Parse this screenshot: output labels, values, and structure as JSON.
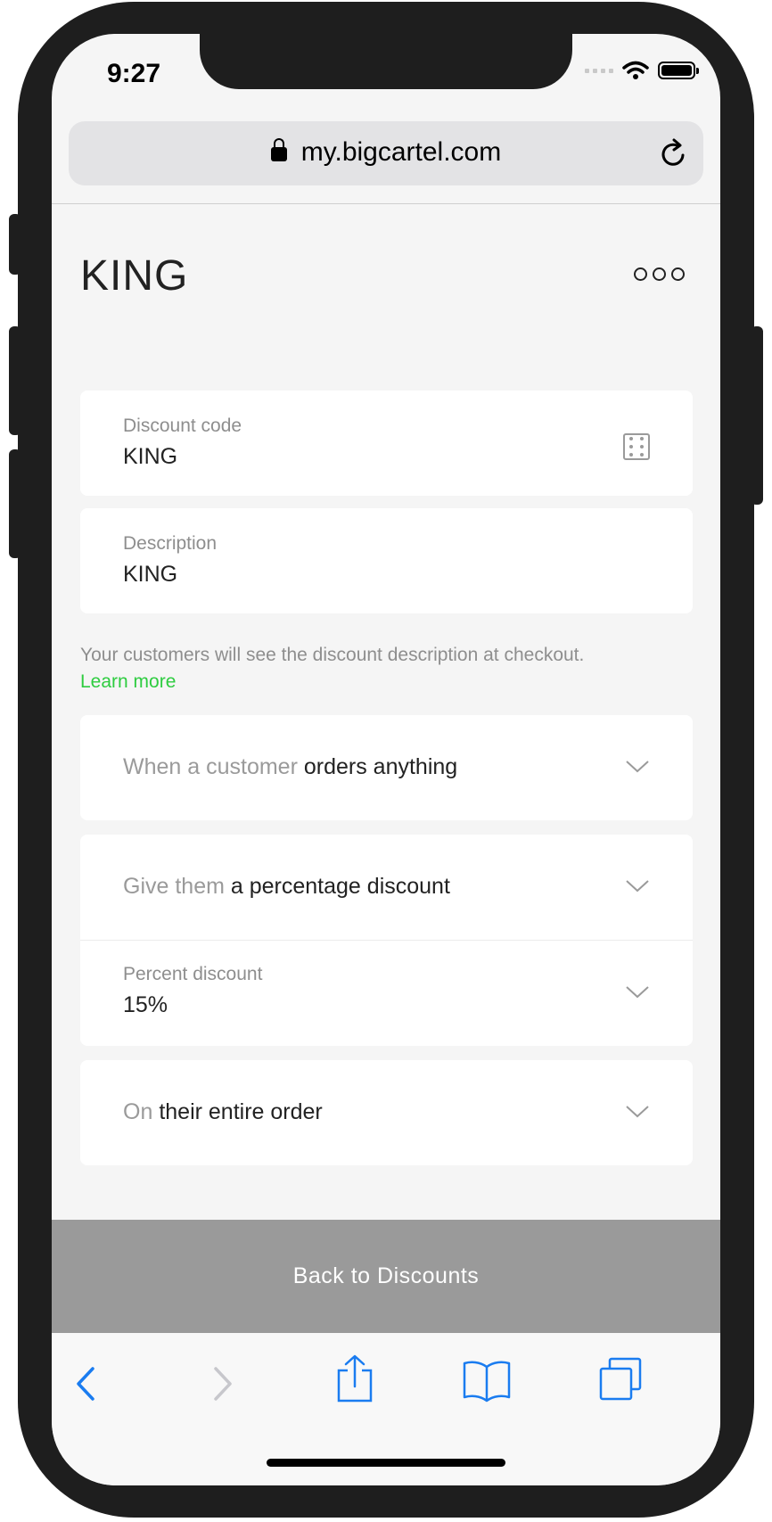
{
  "status": {
    "time": "9:27"
  },
  "browser": {
    "url": "my.bigcartel.com"
  },
  "page": {
    "title": "KING"
  },
  "discount_code": {
    "label": "Discount code",
    "value": "KING"
  },
  "description": {
    "label": "Description",
    "value": "KING"
  },
  "help": {
    "text": "Your customers will see the discount description at checkout.",
    "link": "Learn more"
  },
  "conditions": {
    "when": {
      "prefix": "When a customer",
      "value": "orders anything"
    },
    "give": {
      "prefix": "Give them",
      "value": "a percentage discount"
    },
    "percent": {
      "label": "Percent discount",
      "value": "15%"
    },
    "on": {
      "prefix": "On",
      "value": "their entire order"
    }
  },
  "footer": {
    "back_label": "Back to Discounts"
  },
  "colors": {
    "accent_link": "#2ecc40",
    "ios_blue": "#1a7cf0",
    "footer_bg": "#9a9a9a"
  }
}
